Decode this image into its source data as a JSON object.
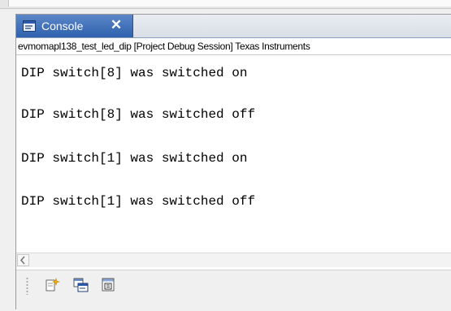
{
  "console": {
    "tab": {
      "label": "Console",
      "close_symbol": "✕",
      "icon": "console-view-icon"
    },
    "session_title": "evmomapl138_test_led_dip [Project Debug Session] Texas Instruments",
    "output_lines": [
      "DIP switch[8] was switched on",
      "DIP switch[8] was switched off",
      "DIP switch[1] was switched on",
      "DIP switch[1] was switched off"
    ]
  },
  "toolbar": {
    "buttons": [
      {
        "name": "new-console-button",
        "icon": "new-console-icon"
      },
      {
        "name": "display-selected-console-button",
        "icon": "display-console-icon"
      },
      {
        "name": "pin-console-button",
        "icon": "pin-console-icon"
      }
    ]
  },
  "scrollbar": {
    "left_arrow": "left-arrow-icon"
  },
  "colors": {
    "tab_active": "#3f70bb",
    "tab_border": "#2c4f86",
    "background": "#f0f0f0"
  }
}
